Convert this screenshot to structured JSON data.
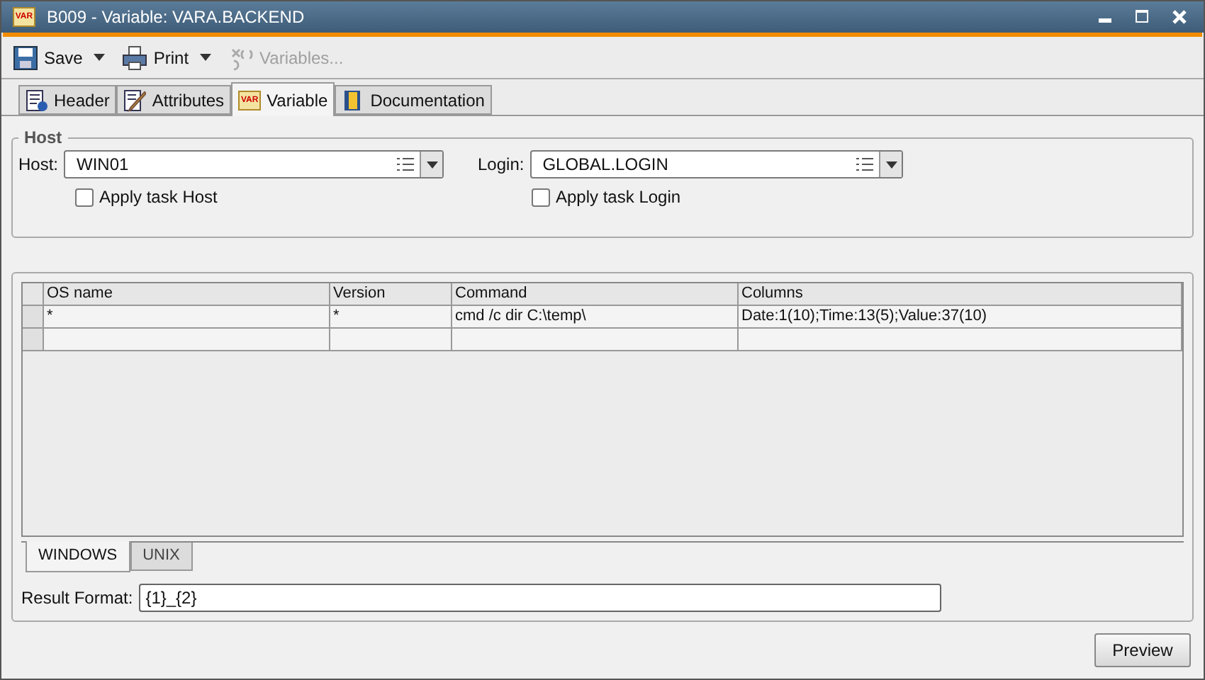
{
  "window": {
    "title": "B009 - Variable: VARA.BACKEND",
    "icon_label": "VAR"
  },
  "toolbar": [
    {
      "label": "Save",
      "kind": "save",
      "dropdown": true,
      "disabled": false
    },
    {
      "label": "Print",
      "kind": "print",
      "dropdown": true,
      "disabled": false
    },
    {
      "label": "Variables...",
      "kind": "variables",
      "dropdown": false,
      "disabled": true
    }
  ],
  "tabs": [
    {
      "label": "Header",
      "kind": "header",
      "selected": false
    },
    {
      "label": "Attributes",
      "kind": "attributes",
      "selected": false
    },
    {
      "label": "Variable",
      "kind": "variable",
      "selected": true,
      "icon_label": "VAR"
    },
    {
      "label": "Documentation",
      "kind": "documentation",
      "selected": false
    }
  ],
  "host_group": {
    "title": "Host",
    "fields": [
      {
        "label": "Host:",
        "value": "WIN01",
        "checkbox": {
          "label": "Apply task Host",
          "checked": false
        }
      },
      {
        "label": "Login:",
        "value": "GLOBAL.LOGIN",
        "checkbox": {
          "label": "Apply task Login",
          "checked": false
        }
      }
    ]
  },
  "table": {
    "columns": [
      "OS name",
      "Version",
      "Command",
      "Columns"
    ],
    "rows": [
      [
        "*",
        "*",
        "cmd /c dir C:\\temp\\",
        "Date:1(10);Time:13(5);Value:37(10)"
      ]
    ]
  },
  "os_tabs": [
    {
      "label": "WINDOWS",
      "selected": true
    },
    {
      "label": "UNIX",
      "selected": false
    }
  ],
  "result_format": {
    "label": "Result Format:",
    "value": "{1}_{2}"
  },
  "buttons": [
    "Preview"
  ]
}
